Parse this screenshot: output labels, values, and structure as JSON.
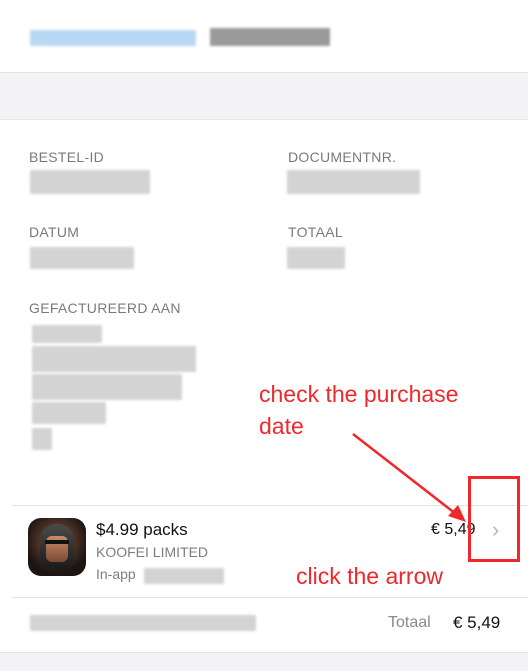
{
  "invoice": {
    "fields": {
      "order_id_label": "BESTEL-ID",
      "document_label": "DOCUMENTNR.",
      "date_label": "DATUM",
      "total_label": "TOTAAL",
      "billed_to_label": "GEFACTUREERD AAN"
    },
    "item": {
      "title": "$4.99 packs",
      "publisher": "KOOFEI LIMITED",
      "type": "In-app",
      "price": "€ 5,49",
      "chevron": "›"
    },
    "summary": {
      "total_label": "Totaal",
      "total_value": "€ 5,49"
    }
  },
  "annotations": {
    "check_date": "check the purchase date",
    "check_date_line1": "check the purchase",
    "check_date_line2": "date",
    "click_arrow": "click the arrow",
    "color": "#f0282c"
  },
  "icons": {
    "app_icon": "spartan-helmet-app-icon",
    "chevron": "chevron-right-icon"
  }
}
